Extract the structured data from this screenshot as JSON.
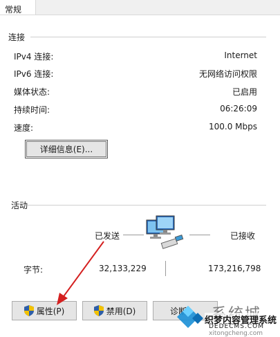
{
  "tab": {
    "label": "常规"
  },
  "connection": {
    "section_label": "连接",
    "rows": [
      {
        "label": "IPv4 连接:",
        "value": "Internet"
      },
      {
        "label": "IPv6 连接:",
        "value": "无网络访问权限"
      },
      {
        "label": "媒体状态:",
        "value": "已启用"
      },
      {
        "label": "持续时间:",
        "value": "06:26:09"
      },
      {
        "label": "速度:",
        "value": "100.0 Mbps"
      }
    ],
    "details_button": "详细信息(E)..."
  },
  "activity": {
    "section_label": "活动",
    "sent_label": "已发送",
    "received_label": "已接收",
    "bytes_label": "字节:",
    "bytes_sent": "32,133,229",
    "bytes_received": "173,216,798",
    "icon": "network-computers-icon"
  },
  "buttons": {
    "properties": "属性(P)",
    "disable": "禁用(D)",
    "diagnose": "诊断"
  },
  "watermark": {
    "line1": "系统城",
    "line2": "织梦内容管理系统",
    "line3": "DEDECMS.COM",
    "line4": "xitongcheng.com"
  },
  "colors": {
    "annotation_arrow": "#d42020",
    "windows_logo": "#1a8fd6"
  }
}
